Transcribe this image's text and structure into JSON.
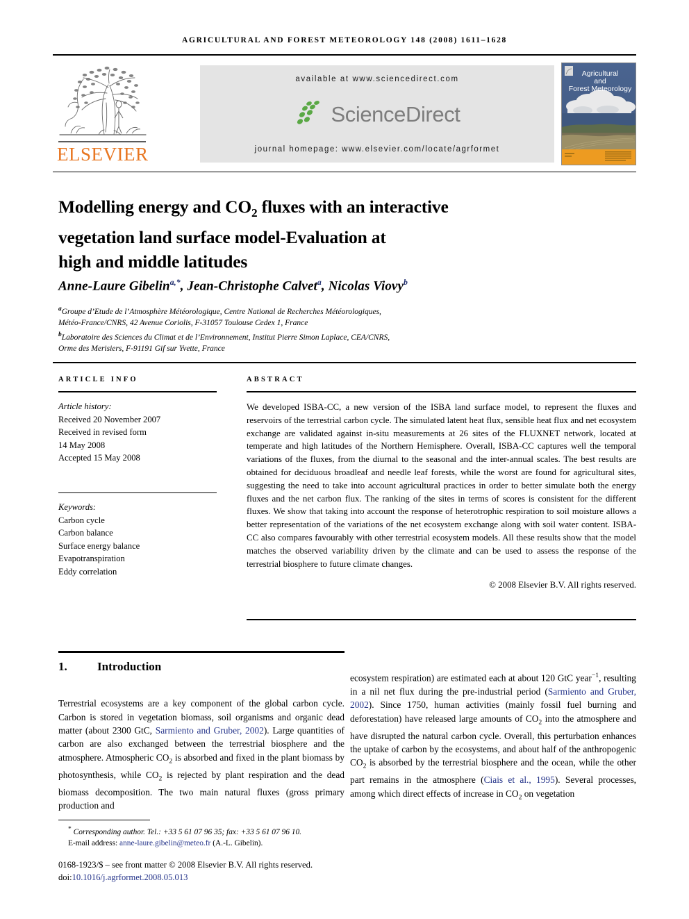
{
  "running_head": "Agricultural and forest meteorology 148 (2008) 1611–1628",
  "masthead": {
    "publisher_name": "ELSEVIER",
    "available_at": "available at www.sciencedirect.com",
    "sciencedirect_wordmark": "ScienceDirect",
    "journal_homepage": "journal homepage: www.elsevier.com/locate/agrformet",
    "cover": {
      "line1": "Agricultural",
      "line2": "and",
      "line3": "Forest Meteorology"
    }
  },
  "article": {
    "title_line1_a": "Modelling energy and CO",
    "title_line1_sub": "2",
    "title_line1_b": " fluxes with an interactive",
    "title_line2": "vegetation land surface model-Evaluation at",
    "title_line3": "high and middle latitudes",
    "authors": [
      {
        "name": "Anne-Laure Gibelin",
        "marks": "a,*"
      },
      {
        "name": "Jean-Christophe Calvet",
        "marks": "a"
      },
      {
        "name": "Nicolas Viovy",
        "marks": "b"
      }
    ],
    "affiliations": [
      {
        "mark": "a",
        "line1": "Groupe d’Etude de l’Atmosphère Météorologique, Centre National de Recherches Météorologiques,",
        "line2": "Météo-France/CNRS, 42 Avenue Coriolis, F-31057 Toulouse Cedex 1, France"
      },
      {
        "mark": "b",
        "line1": "Laboratoire des Sciences du Climat et de l’Environnement, Institut Pierre Simon Laplace, CEA/CNRS,",
        "line2": "Orme des Merisiers, F-91191 Gif sur Yvette, France"
      }
    ]
  },
  "article_info": {
    "heading": "Article info",
    "history_label": "Article history:",
    "history": [
      "Received 20 November 2007",
      "Received in revised form",
      "14 May 2008",
      "Accepted 15 May 2008"
    ],
    "keywords_label": "Keywords:",
    "keywords": [
      "Carbon cycle",
      "Carbon balance",
      "Surface energy balance",
      "Evapotranspiration",
      "Eddy correlation"
    ]
  },
  "abstract": {
    "heading": "Abstract",
    "text": "We developed ISBA-CC, a new version of the ISBA land surface model, to represent the fluxes and reservoirs of the terrestrial carbon cycle. The simulated latent heat flux, sensible heat flux and net ecosystem exchange are validated against in-situ measurements at 26 sites of the FLUXNET network, located at temperate and high latitudes of the Northern Hemisphere. Overall, ISBA-CC captures well the temporal variations of the fluxes, from the diurnal to the seasonal and the inter-annual scales. The best results are obtained for deciduous broadleaf and needle leaf forests, while the worst are found for agricultural sites, suggesting the need to take into account agricultural practices in order to better simulate both the energy fluxes and the net carbon flux. The ranking of the sites in terms of scores is consistent for the different fluxes. We show that taking into account the response of heterotrophic respiration to soil moisture allows a better representation of the variations of the net ecosystem exchange along with soil water content. ISBA-CC also compares favourably with other terrestrial ecosystem models. All these results show that the model matches the observed variability driven by the climate and can be used to assess the response of the terrestrial biosphere to future climate changes.",
    "copyright": "© 2008 Elsevier B.V. All rights reserved."
  },
  "body": {
    "section_number": "1.",
    "section_title": "Introduction",
    "left_column": {
      "p1_a": "Terrestrial ecosystems are a key component of the global carbon cycle. Carbon is stored in vegetation biomass, soil organisms and organic dead matter (about 2300 GtC, ",
      "p1_cite1": "Sarmiento and Gruber, 2002",
      "p1_b": "). Large quantities of carbon are also exchanged between the terrestrial biosphere and the atmosphere. Atmospheric CO",
      "p1_sub1": "2",
      "p1_c": " is absorbed and fixed in the plant biomass by photosynthesis, while CO",
      "p1_sub2": "2",
      "p1_d": " is rejected by plant respiration and the dead biomass decomposition. The two main natural fluxes (gross primary production and"
    },
    "right_column": {
      "p2_a": "ecosystem respiration) are estimated each at about 120 GtC year",
      "p2_sup": "−1",
      "p2_b": ", resulting in a nil net flux during the pre-industrial period (",
      "p2_cite1": "Sarmiento and Gruber, 2002",
      "p2_c": "). Since 1750, human activities (mainly fossil fuel burning and deforestation) have released large amounts of CO",
      "p2_sub1": "2",
      "p2_d": " into the atmosphere and have disrupted the natural carbon cycle. Overall, this perturbation enhances the uptake of carbon by the ecosystems, and about half of the anthropogenic CO",
      "p2_sub2": "2",
      "p2_e": " is absorbed by the terrestrial biosphere and the ocean, while the other part remains in the atmosphere (",
      "p2_cite2": "Ciais et al., 1995",
      "p2_f": "). Several processes, among which direct effects of increase in CO",
      "p2_sub3": "2",
      "p2_g": " on vegetation"
    }
  },
  "footer": {
    "corresponding_marker": "*",
    "corresponding_text": "Corresponding author. Tel.: +33 5 61 07 96 35; fax: +33 5 61 07 96 10.",
    "email_label": "E-mail address:",
    "email": "anne-laure.gibelin@meteo.fr",
    "email_owner": "(A.-L. Gibelin).",
    "imprint_line": "0168-1923/$ – see front matter © 2008 Elsevier B.V. All rights reserved.",
    "doi_label": "doi:",
    "doi_value": "10.1016/j.agrformet.2008.05.013"
  },
  "colors": {
    "elsevier_orange": "#E87722",
    "sciencedirect_green": "#5aa845",
    "sciencedirect_gray": "#7d7d7d",
    "link_blue": "#25348a",
    "banner_gray": "#e4e4e4"
  }
}
